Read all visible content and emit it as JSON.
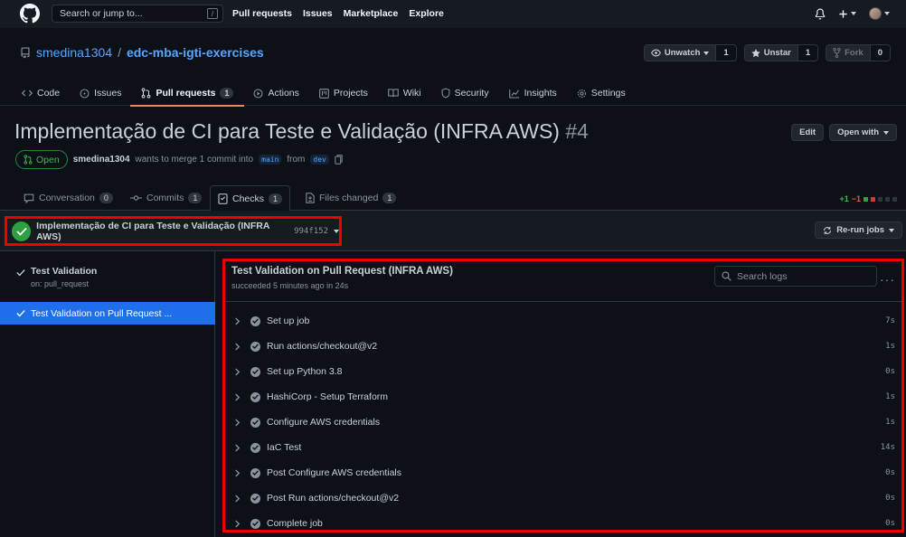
{
  "top": {
    "search_placeholder": "Search or jump to...",
    "search_key": "/",
    "nav": [
      "Pull requests",
      "Issues",
      "Marketplace",
      "Explore"
    ]
  },
  "repo": {
    "owner": "smedina1304",
    "separator": "/",
    "name": "edc-mba-igti-exercises",
    "unwatch_label": "Unwatch",
    "watch_count": "1",
    "unstar_label": "Unstar",
    "star_count": "1",
    "fork_label": "Fork",
    "fork_count": "0",
    "tabs": [
      {
        "label": "Code",
        "icon": "code-icon"
      },
      {
        "label": "Issues",
        "icon": "issue-icon"
      },
      {
        "label": "Pull requests",
        "icon": "pull-request-icon",
        "count": "1"
      },
      {
        "label": "Actions",
        "icon": "play-icon"
      },
      {
        "label": "Projects",
        "icon": "project-icon"
      },
      {
        "label": "Wiki",
        "icon": "book-icon"
      },
      {
        "label": "Security",
        "icon": "shield-icon"
      },
      {
        "label": "Insights",
        "icon": "graph-icon"
      },
      {
        "label": "Settings",
        "icon": "gear-icon"
      }
    ]
  },
  "pr": {
    "title": "Implementação de CI para Teste e Validação (INFRA AWS)",
    "number": "#4",
    "edit_label": "Edit",
    "open_with_label": "Open with",
    "status": "Open",
    "author": "smedina1304",
    "merge_text": "wants to merge 1 commit into",
    "base_branch": "main",
    "from_text": "from",
    "head_branch": "dev",
    "tabs": [
      {
        "label": "Conversation",
        "count": "0"
      },
      {
        "label": "Commits",
        "count": "1"
      },
      {
        "label": "Checks",
        "count": "1"
      },
      {
        "label": "Files changed",
        "count": "1"
      }
    ],
    "additions": "+1",
    "deletions": "−1"
  },
  "checks": {
    "title": "Implementação de CI para Teste e Validação (INFRA AWS)",
    "commit": "994f152",
    "rerun_label": "Re-run jobs",
    "workflow_name": "Test Validation",
    "workflow_trigger": "on: pull_request",
    "job_short": "Test Validation on Pull Request ..."
  },
  "log": {
    "title": "Test Validation on Pull Request (INFRA AWS)",
    "subtitle": "succeeded 5 minutes ago in 24s",
    "search_placeholder": "Search logs",
    "steps": [
      {
        "name": "Set up job",
        "duration": "7s"
      },
      {
        "name": "Run actions/checkout@v2",
        "duration": "1s"
      },
      {
        "name": "Set up Python 3.8",
        "duration": "0s"
      },
      {
        "name": "HashiCorp - Setup Terraform",
        "duration": "1s"
      },
      {
        "name": "Configure AWS credentials",
        "duration": "1s"
      },
      {
        "name": "IaC Test",
        "duration": "14s"
      },
      {
        "name": "Post Configure AWS credentials",
        "duration": "0s"
      },
      {
        "name": "Post Run actions/checkout@v2",
        "duration": "0s"
      },
      {
        "name": "Complete job",
        "duration": "0s"
      }
    ]
  },
  "colors": {
    "background": "#0d1117",
    "header": "#161b22",
    "accent_blue": "#58a6ff",
    "success_green": "#2ea043",
    "highlight_red": "#ee0000",
    "selected_job": "#1f6feb"
  }
}
